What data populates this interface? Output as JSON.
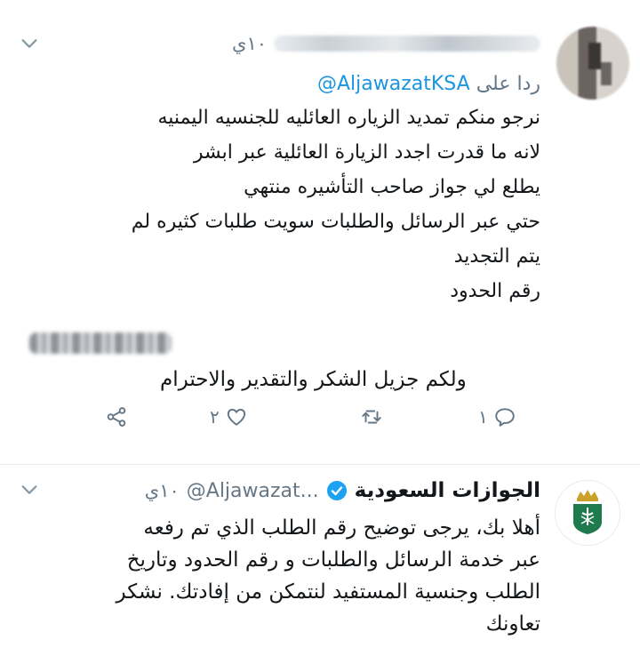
{
  "tweet1": {
    "time": "١٠ي",
    "reply_prefix": "ردا على",
    "reply_mention": "@AljawazatKSA",
    "body_lines": [
      "نرجو منكم تمديد الزياره العائليه للجنسيه اليمنيه",
      "لانه ما قدرت اجدد الزيارة العائلية عبر ابشر",
      "يطلع لي جواز صاحب التأشيره منتهي",
      "حتي عبر الرسائل والطلبات سويت طلبات كثيره لم",
      "يتم التجديد",
      "رقم الحدود"
    ],
    "thanks_line": "ولكم جزيل الشكر والتقدير والاحترام",
    "actions": {
      "reply_count": "١",
      "like_count": "٢"
    }
  },
  "tweet2": {
    "name": "الجوازات السعودية",
    "handle": "@Aljawazat...",
    "time": "١٠ي",
    "body_lines": [
      "أهلا بك، يرجى توضيح رقم الطلب الذي تم رفعه",
      "عبر خدمة الرسائل والطلبات و رقم الحدود وتاريخ",
      "الطلب وجنسية المستفيد لنتمكن من إفادتك. نشكر",
      "تعاونك"
    ]
  },
  "colors": {
    "text": "#14171a",
    "secondary": "#657786",
    "link": "#1b95e0",
    "verified": "#1da1f2",
    "emblem_green": "#1f7a4d",
    "emblem_gold": "#c9a227"
  }
}
